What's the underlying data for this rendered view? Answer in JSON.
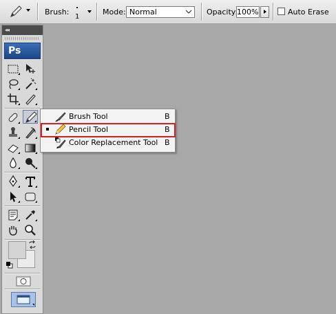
{
  "options_bar": {
    "brush_label": "Brush:",
    "brush_size": "1",
    "mode_label": "Mode:",
    "mode_value": "Normal",
    "opacity_label": "Opacity:",
    "opacity_value": "100%",
    "auto_erase_label": "Auto Erase",
    "auto_erase_checked": false
  },
  "toolbox": {
    "logo": "Ps",
    "collapse_glyph": "◂◂"
  },
  "flyout": {
    "items": [
      {
        "label": "Brush Tool",
        "shortcut": "B",
        "icon": "brush-icon",
        "selected": false
      },
      {
        "label": "Pencil Tool",
        "shortcut": "B",
        "icon": "pencil-icon",
        "selected": true
      },
      {
        "label": "Color Replacement Tool",
        "shortcut": "B",
        "icon": "color-replacement-icon",
        "selected": false
      }
    ]
  },
  "colors": {
    "canvas": "#a8a8a8",
    "highlight": "#d42020",
    "foreground": "#d4d4d4",
    "background": "#ececec"
  }
}
